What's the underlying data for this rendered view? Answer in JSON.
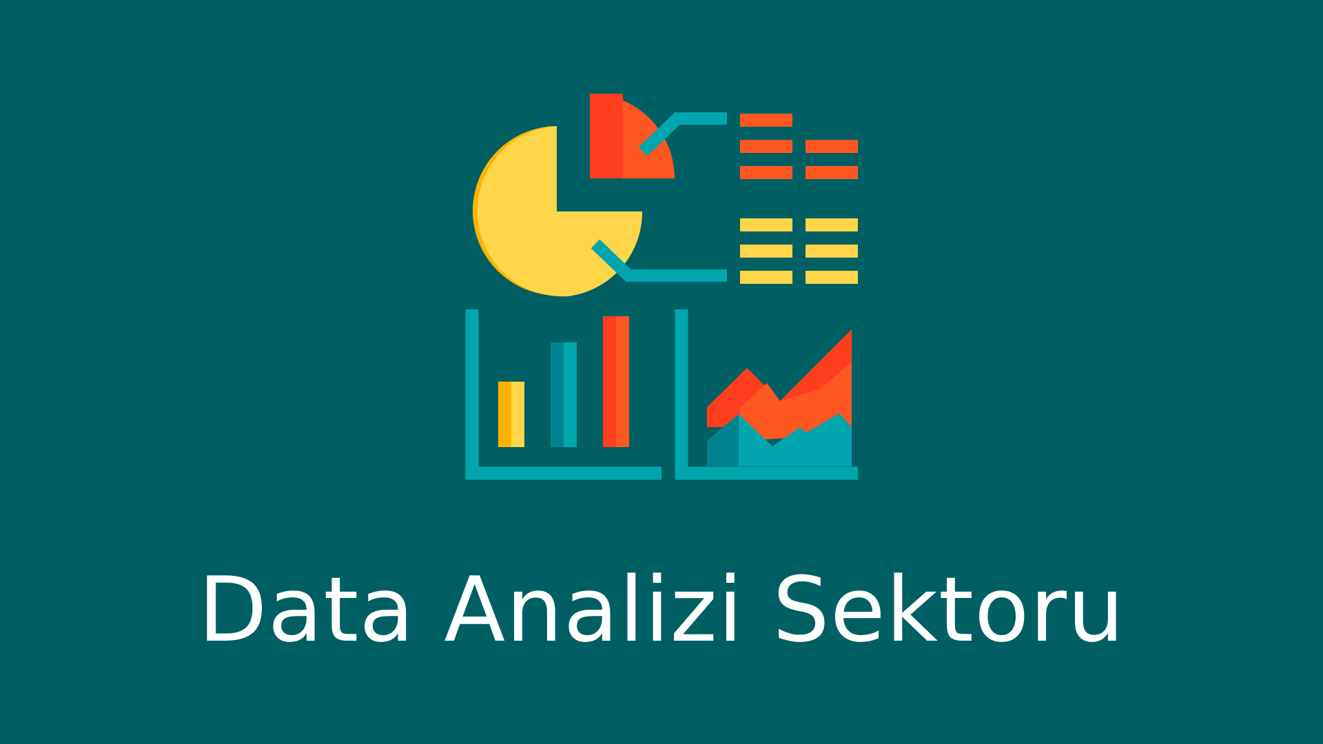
{
  "page": {
    "title": "Data Analizi Sektoru"
  },
  "colors": {
    "background": "#005f63",
    "teal": "#00a5ad",
    "teal_dark": "#00838f",
    "yellow": "#ffd54a",
    "yellow_dark": "#ffb300",
    "orange": "#ff5722",
    "red": "#ff3d1f",
    "white": "#ffffff"
  },
  "illustration": {
    "icon": "data-analytics-icon"
  }
}
